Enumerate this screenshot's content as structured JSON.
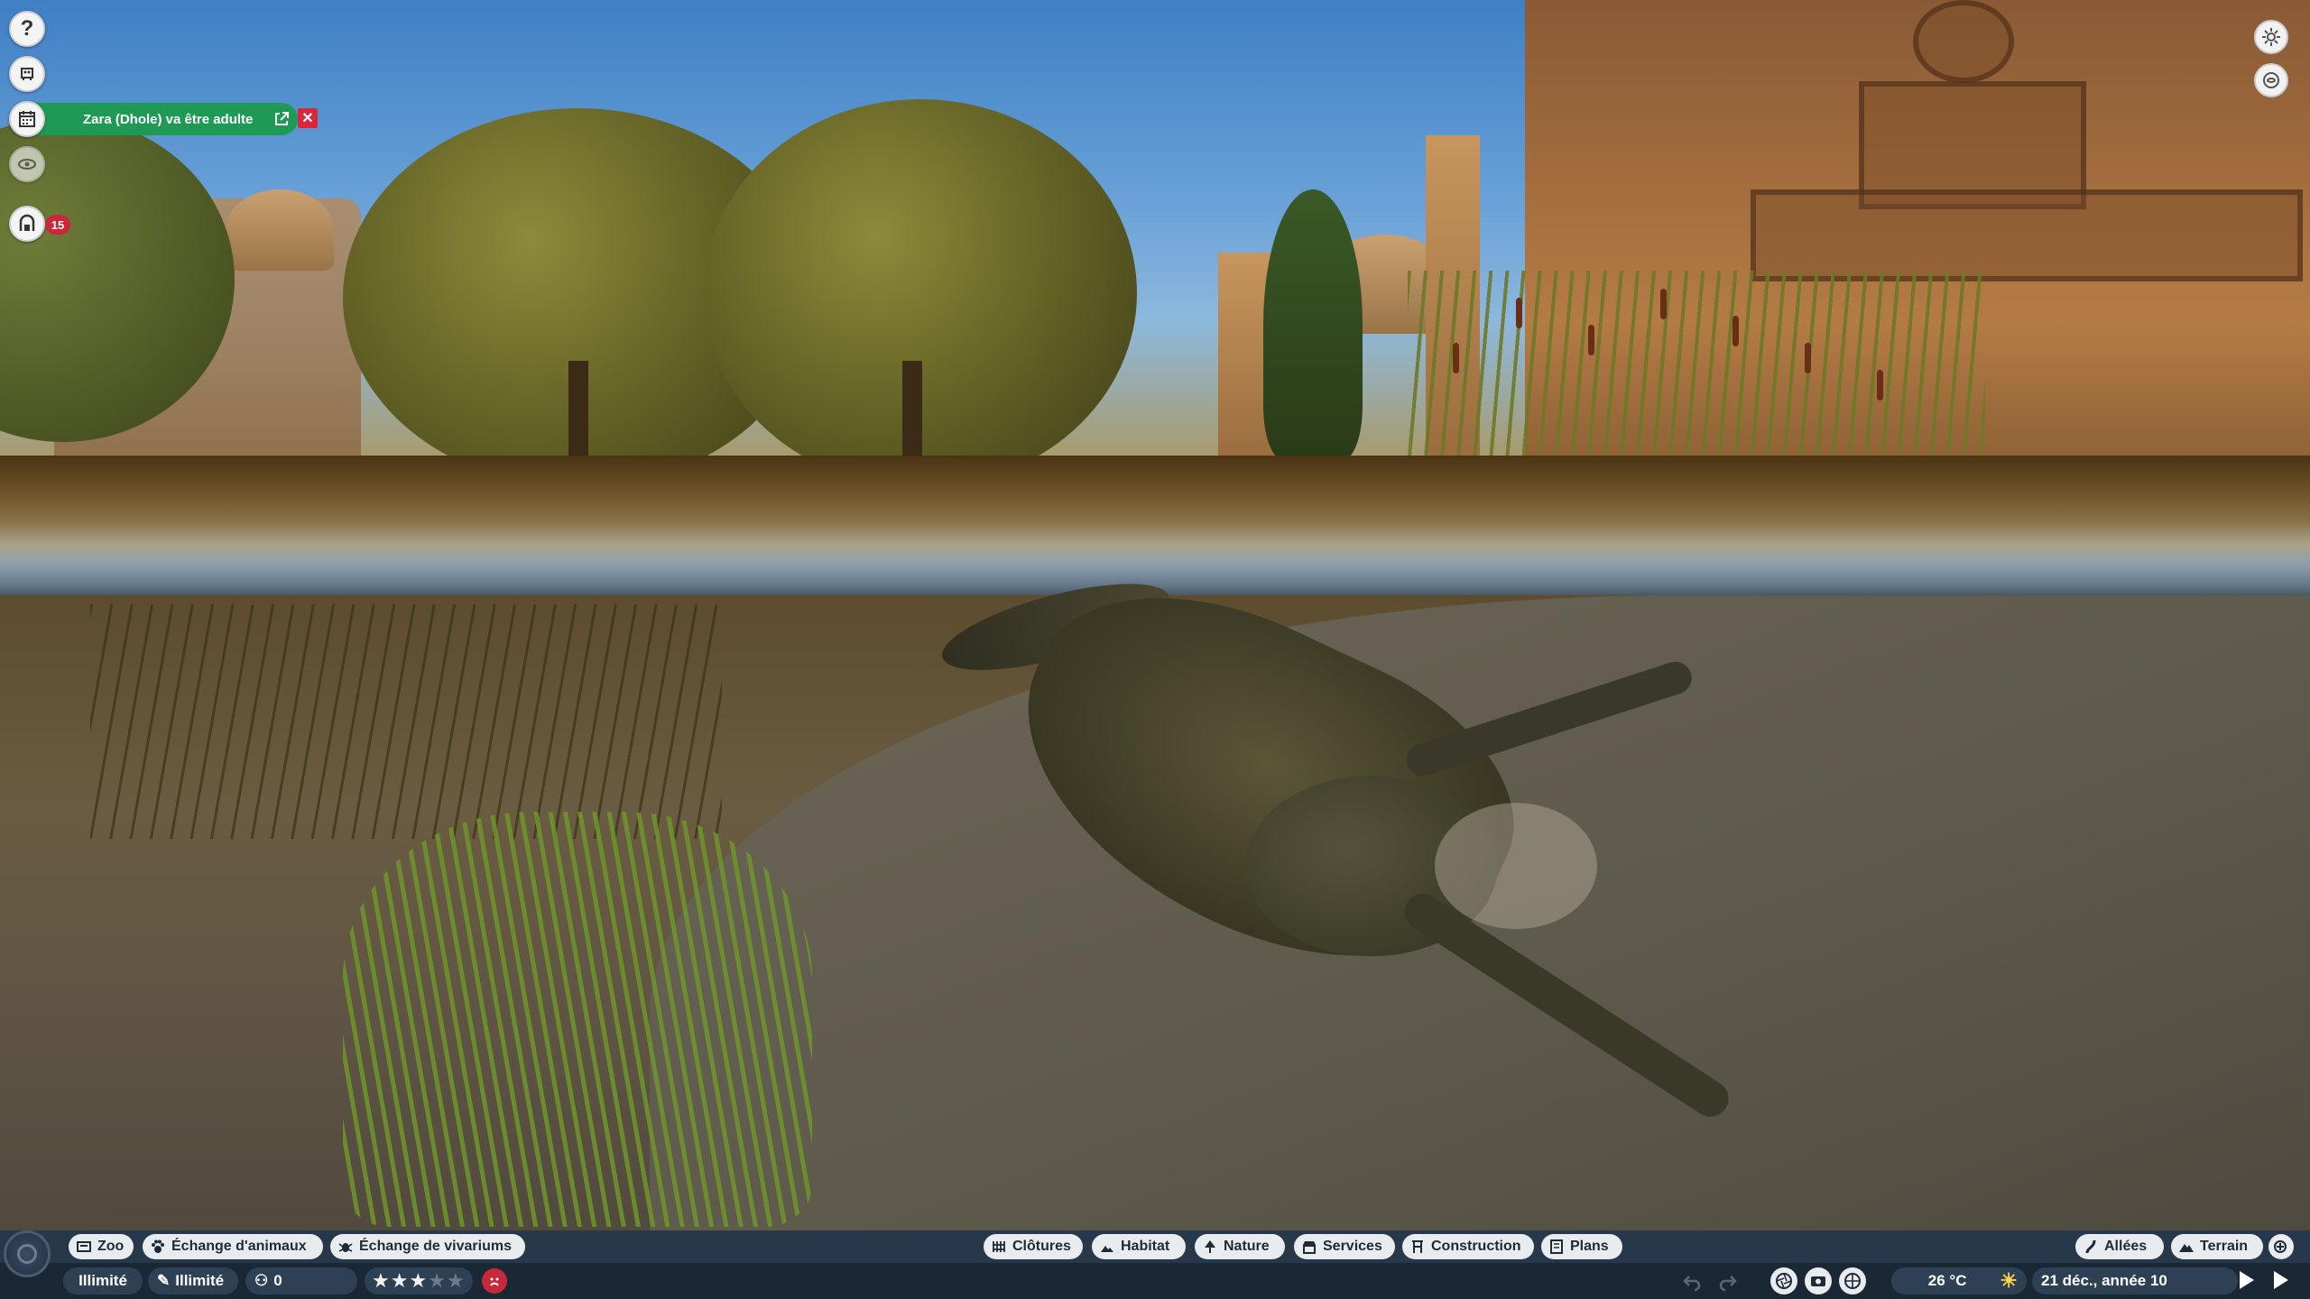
{
  "notification": {
    "text": "Zara (Dhole) va être adulte",
    "open_icon": "external-link-icon",
    "close_label": "✕"
  },
  "left_hud": {
    "help_label": "?",
    "guests_badge": "15",
    "icons": [
      "help-icon",
      "animal-icon",
      "calendar-icon",
      "eye-icon",
      "guest-icon"
    ]
  },
  "right_hud": {
    "icons": [
      "settings-icon",
      "camera-view-icon"
    ]
  },
  "toolbar_left": {
    "zoo": "Zoo",
    "animal_exchange": "Échange d'animaux",
    "vivarium_exchange": "Échange de vivariums"
  },
  "toolbar_center": {
    "barriers": "Clôtures",
    "habitat": "Habitat",
    "nature": "Nature",
    "services": "Services",
    "construction": "Construction",
    "blueprints": "Plans"
  },
  "toolbar_right": {
    "paths": "Allées",
    "terrain": "Terrain"
  },
  "status_bar": {
    "money": "Illimité",
    "research": "Illimité",
    "guests_count": "0",
    "rating_stars": 3,
    "rating_max": 5,
    "temperature": "26 °C",
    "date": "21 déc., année 10",
    "weather_icon": "sun-icon"
  },
  "colors": {
    "notification_green": "#1f9a55",
    "alert_red": "#c8283a",
    "bar_dark": "#1c2a38",
    "tab_light": "#e9ecef"
  }
}
